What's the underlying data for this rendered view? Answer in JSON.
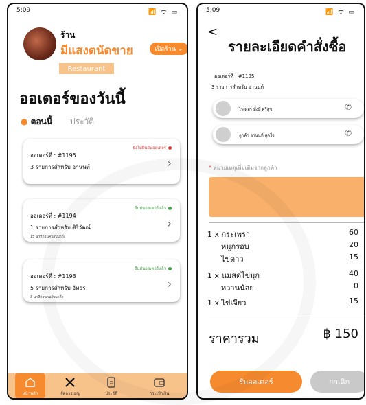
{
  "left_screen": {
    "status_time": "5:09",
    "status_icons": "📶 ᯤ ▭",
    "shop_label": "ร้าน",
    "shop_name": "มีแสงตนัดขาย",
    "open_button": "เปิดร้าน ⌄",
    "restaurant_badge": "Restaurant",
    "page_title": "ออเดอร์ของวันนี้",
    "tabs": {
      "now": "ตอนนี้",
      "history": "ประวัติ"
    },
    "orders": [
      {
        "status": "ยังไม่ยืนยันออเดอร์",
        "status_color": "#e53935",
        "id": "ออเดอร์ที่ : #1195",
        "summary": "3 รายการสำหรับ  อานนท์",
        "time": ""
      },
      {
        "status": "ยืนยันออเดอร์แล้ว",
        "status_color": "#43a047",
        "id": "ออเดอร์ที่ : #1194",
        "summary": "1 รายการสำหรับ  ศิริวัฒน์",
        "time": "15 นาทีก่อนคนรับมาถึง"
      },
      {
        "status": "ยืนยันออเดอร์แล้ว",
        "status_color": "#43a047",
        "id": "ออเดอร์ที่ : #1193",
        "summary": "5 รายการสำหรับ  อัทธร",
        "time": "3 นาทีก่อนคนรับมาถึง"
      }
    ],
    "nav": [
      {
        "label": "หน้าหลัก",
        "icon": "home-icon"
      },
      {
        "label": "จัดการเมนู",
        "icon": "utensils-icon"
      },
      {
        "label": "ประวัติ",
        "icon": "document-icon"
      },
      {
        "label": "กระเป๋าเงิน",
        "icon": "wallet-icon"
      }
    ]
  },
  "right_screen": {
    "status_time": "5:09",
    "status_icons": "📶 ᯤ ▭",
    "title": "รายละเอียดคำสั่งซื้อ",
    "order_id": "ออเดอร์ที่ : #1195",
    "order_summary": "3 รายการสำหรับ  อานนท์",
    "rider": "ไรเดอร์ มั่งมี ศรีสุข",
    "customer": "ลูกค้า อานนท์ สุดใจ",
    "note_label": "หมายเหตุเพิ่มเติมจากลูกค้า",
    "items": [
      {
        "text": "1 x กระเพรา",
        "price": "60",
        "indent": false
      },
      {
        "text": "หมูกรอบ",
        "price": "20",
        "indent": true
      },
      {
        "text": "ไข่ดาว",
        "price": "15",
        "indent": true
      },
      {
        "text": "1 x นมสดไข่มุก",
        "price": "40",
        "indent": false
      },
      {
        "text": "หวานน้อย",
        "price": "0",
        "indent": true
      },
      {
        "text": "1 x ไข่เจียว",
        "price": "15",
        "indent": false
      }
    ],
    "total_label": "ราคารวม",
    "total_value": "฿ 150",
    "accept_button": "รับออเดอร์",
    "cancel_button": "ยกเลิก"
  },
  "colors": {
    "accent": "#f58a2f",
    "accent_light": "#f8c28b"
  }
}
